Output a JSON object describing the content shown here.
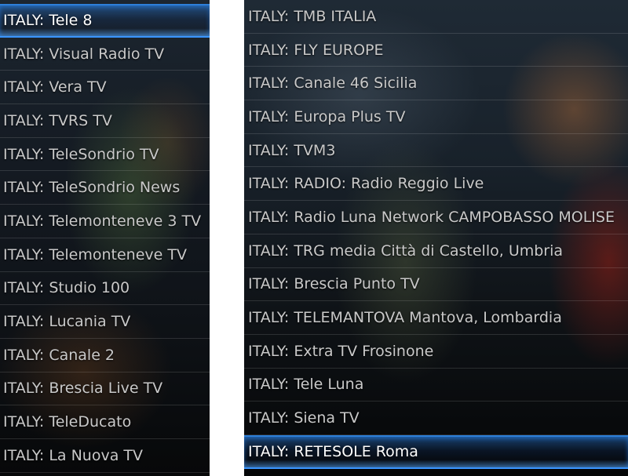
{
  "left_list": {
    "items": [
      {
        "label": "ITALY: Tele 8",
        "selected": true
      },
      {
        "label": "ITALY: Visual Radio TV"
      },
      {
        "label": "ITALY: Vera TV"
      },
      {
        "label": "ITALY: TVRS TV"
      },
      {
        "label": "ITALY: TeleSondrio TV"
      },
      {
        "label": "ITALY: TeleSondrio News"
      },
      {
        "label": "ITALY: Telemonteneve 3 TV"
      },
      {
        "label": "ITALY: Telemonteneve TV"
      },
      {
        "label": "ITALY: Studio 100"
      },
      {
        "label": "ITALY: Lucania TV"
      },
      {
        "label": "ITALY: Canale 2"
      },
      {
        "label": "ITALY: Brescia Live TV"
      },
      {
        "label": "ITALY: TeleDucato"
      },
      {
        "label": "ITALY: La Nuova TV"
      }
    ]
  },
  "right_list": {
    "items": [
      {
        "label": "ITALY: TMB ITALIA"
      },
      {
        "label": "ITALY: FLY EUROPE"
      },
      {
        "label": "ITALY: Canale 46 Sicilia"
      },
      {
        "label": "ITALY: Europa Plus TV"
      },
      {
        "label": "ITALY: TVM3"
      },
      {
        "label": "ITALY: RADIO: Radio Reggio Live"
      },
      {
        "label": "ITALY: Radio Luna Network  CAMPOBASSO MOLISE"
      },
      {
        "label": "ITALY: TRG media Città di Castello, Umbria"
      },
      {
        "label": "ITALY: Brescia Punto TV"
      },
      {
        "label": "ITALY: TELEMANTOVA  Mantova, Lombardia"
      },
      {
        "label": "ITALY: Extra TV Frosinone"
      },
      {
        "label": "ITALY: Tele Luna"
      },
      {
        "label": "ITALY: Siena TV"
      },
      {
        "label": "ITALY: RETESOLE Roma",
        "selected": true
      }
    ]
  },
  "colors": {
    "selection_accent": "#3a95ff",
    "item_text": "#c9c9c9",
    "selected_text": "#ffffff"
  }
}
